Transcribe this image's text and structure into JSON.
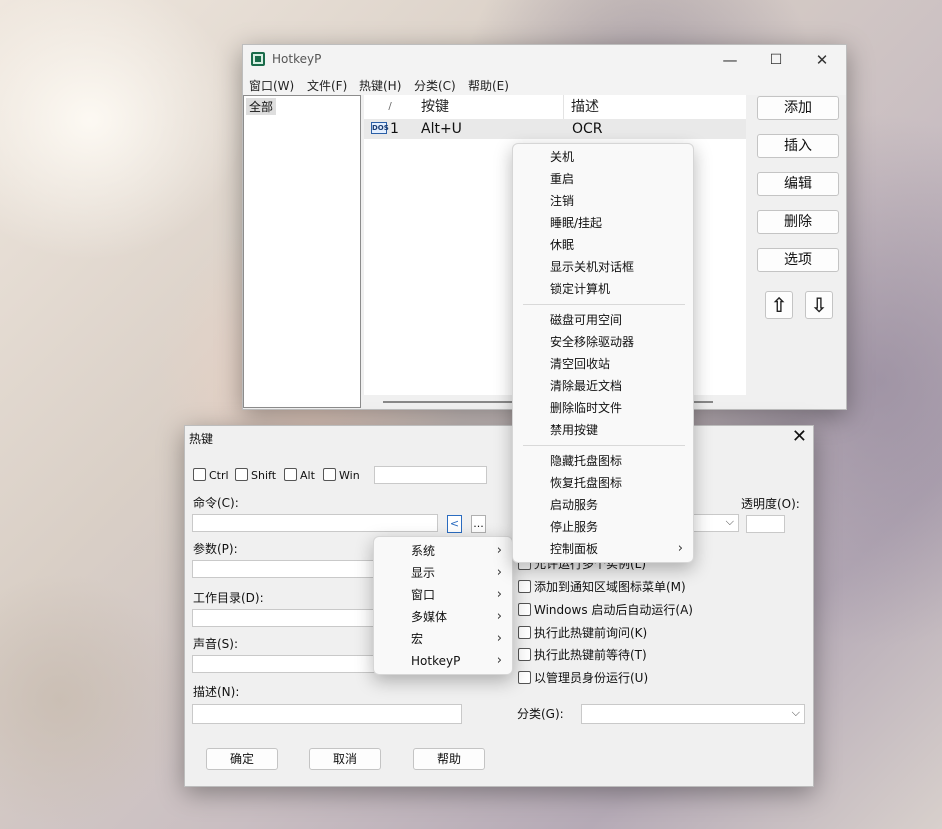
{
  "main_window": {
    "title": "HotkeyP",
    "caption": {
      "minimize": "—",
      "maximize": "☐",
      "close": "✕"
    },
    "menu": [
      "窗口(W)",
      "文件(F)",
      "热键(H)",
      "分类(C)",
      "帮助(E)"
    ],
    "categories": [
      "全部"
    ],
    "table": {
      "headers": {
        "num": "/",
        "key": "按键",
        "desc": "描述"
      },
      "rows": [
        {
          "icon_text": "DOS",
          "num": "1",
          "key": "Alt+U",
          "desc": "OCR"
        }
      ]
    },
    "buttons": {
      "add": "添加",
      "insert": "插入",
      "edit": "编辑",
      "delete": "删除",
      "options": "选项"
    },
    "arrows": {
      "up": "⇧",
      "down": "⇩"
    }
  },
  "hotkey_dialog": {
    "title": "热键",
    "close": "✕",
    "modifiers": [
      "Ctrl",
      "Shift",
      "Alt",
      "Win"
    ],
    "labels": {
      "command": "命令(C):",
      "params": "参数(P):",
      "workdir": "工作目录(D):",
      "sound": "声音(S):",
      "description": "描述(N):",
      "opacity": "透明度(O):",
      "category": "分类(G):"
    },
    "command_buttons": {
      "menu": "<",
      "browse": "..."
    },
    "checkboxes": [
      "允许运行多个实例(L)",
      "添加到通知区域图标菜单(M)",
      "Windows 启动后自动运行(A)",
      "执行此热键前询问(K)",
      "执行此热键前等待(T)",
      "以管理员身份运行(U)"
    ],
    "buttons": {
      "ok": "确定",
      "cancel": "取消",
      "help": "帮助"
    },
    "dropdown_arrow": "⌵"
  },
  "command_menu": {
    "items": [
      "系统",
      "显示",
      "窗口",
      "多媒体",
      "宏",
      "HotkeyP"
    ],
    "submenu_arrow": "›"
  },
  "system_submenu": {
    "group1": [
      "关机",
      "重启",
      "注销",
      "睡眠/挂起",
      "休眠",
      "显示关机对话框",
      "锁定计算机"
    ],
    "group2": [
      "磁盘可用空间",
      "安全移除驱动器",
      "清空回收站",
      "清除最近文档",
      "删除临时文件",
      "禁用按键"
    ],
    "group3": [
      "隐藏托盘图标",
      "恢复托盘图标",
      "启动服务",
      "停止服务",
      "控制面板"
    ],
    "submenu_arrow": "›"
  }
}
